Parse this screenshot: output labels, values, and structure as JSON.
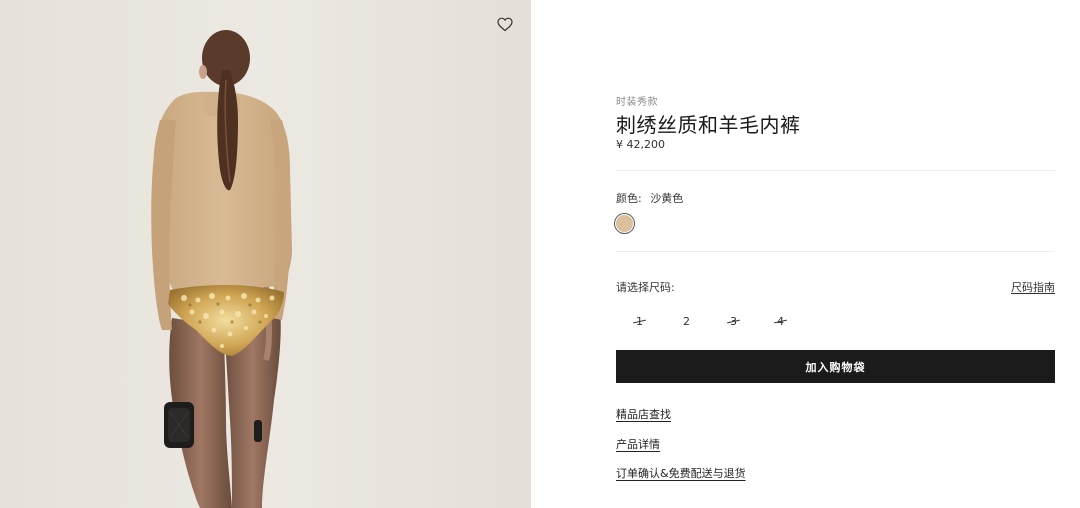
{
  "product": {
    "category": "时装秀款",
    "title": "刺绣丝质和羊毛内裤",
    "price": "¥ 42,200"
  },
  "color": {
    "label": "颜色:",
    "value": "沙黄色",
    "swatch_hex": "#dcbf9b"
  },
  "size": {
    "label": "请选择尺码:",
    "guide_label": "尺码指南",
    "options": [
      {
        "label": "1",
        "available": false
      },
      {
        "label": "2",
        "available": true
      },
      {
        "label": "3",
        "available": false
      },
      {
        "label": "4",
        "available": false
      }
    ]
  },
  "actions": {
    "add_to_bag": "加入购物袋"
  },
  "links": {
    "store_finder": "精品店查找",
    "product_details": "产品详情",
    "order_shipping_returns": "订单确认&免费配送与退货"
  },
  "colors": {
    "button_bg": "#1b1b1b",
    "image_bg": "#e9e5de",
    "sweater": "#d5b690",
    "sequins": "#c9a458"
  },
  "icons": {
    "wishlist": "heart-outline-icon"
  }
}
